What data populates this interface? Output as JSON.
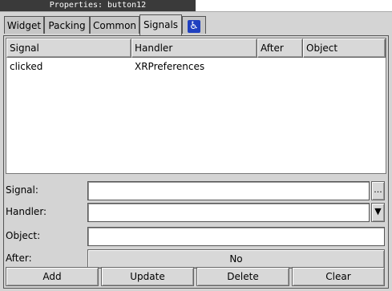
{
  "window": {
    "title": "Properties: button12"
  },
  "tabs": [
    {
      "label": "Widget"
    },
    {
      "label": "Packing"
    },
    {
      "label": "Common"
    },
    {
      "label": "Signals"
    },
    {
      "label": "",
      "icon": "accessibility-icon"
    }
  ],
  "signals_table": {
    "columns": [
      "Signal",
      "Handler",
      "After",
      "Object"
    ],
    "rows": [
      {
        "signal": "clicked",
        "handler": "XRPreferences",
        "after": "",
        "object": ""
      }
    ]
  },
  "form": {
    "signal_label": "Signal:",
    "signal_value": "",
    "signal_browse_label": "...",
    "handler_label": "Handler:",
    "handler_value": "",
    "object_label": "Object:",
    "object_value": "",
    "after_label": "After:",
    "after_toggle_label": "No"
  },
  "actions": {
    "add_label": "Add",
    "update_label": "Update",
    "delete_label": "Delete",
    "clear_label": "Clear"
  },
  "colors": {
    "accessibility_icon": "#2040c0",
    "titlebar": "#3a3a3a"
  }
}
